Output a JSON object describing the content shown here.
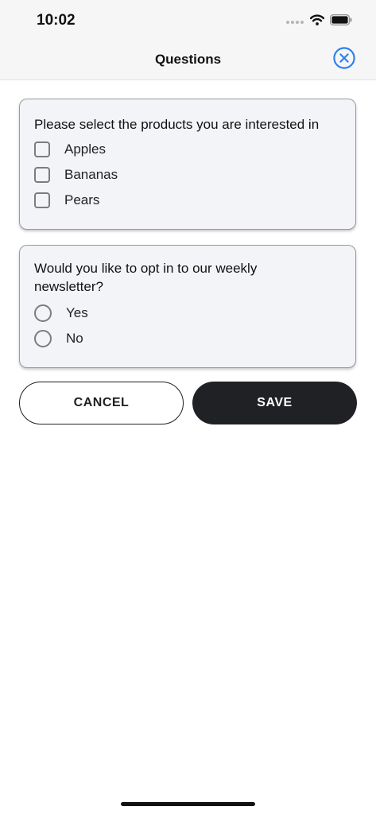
{
  "status_bar": {
    "time": "10:02",
    "icons": [
      "signal-dots-icon",
      "wifi-icon",
      "battery-icon"
    ]
  },
  "nav": {
    "title": "Questions",
    "close_icon": "close-circle-icon",
    "accent_color": "#2f80ed"
  },
  "questions": [
    {
      "type": "checkbox",
      "text": "Please select the products you are interested in",
      "options": [
        {
          "label": "Apples",
          "checked": false
        },
        {
          "label": "Bananas",
          "checked": false
        },
        {
          "label": "Pears",
          "checked": false
        }
      ]
    },
    {
      "type": "radio",
      "text": "Would you like to opt in to our weekly newsletter?",
      "options": [
        {
          "label": "Yes",
          "selected": false
        },
        {
          "label": "No",
          "selected": false
        }
      ]
    }
  ],
  "actions": {
    "cancel_label": "CANCEL",
    "save_label": "SAVE"
  }
}
